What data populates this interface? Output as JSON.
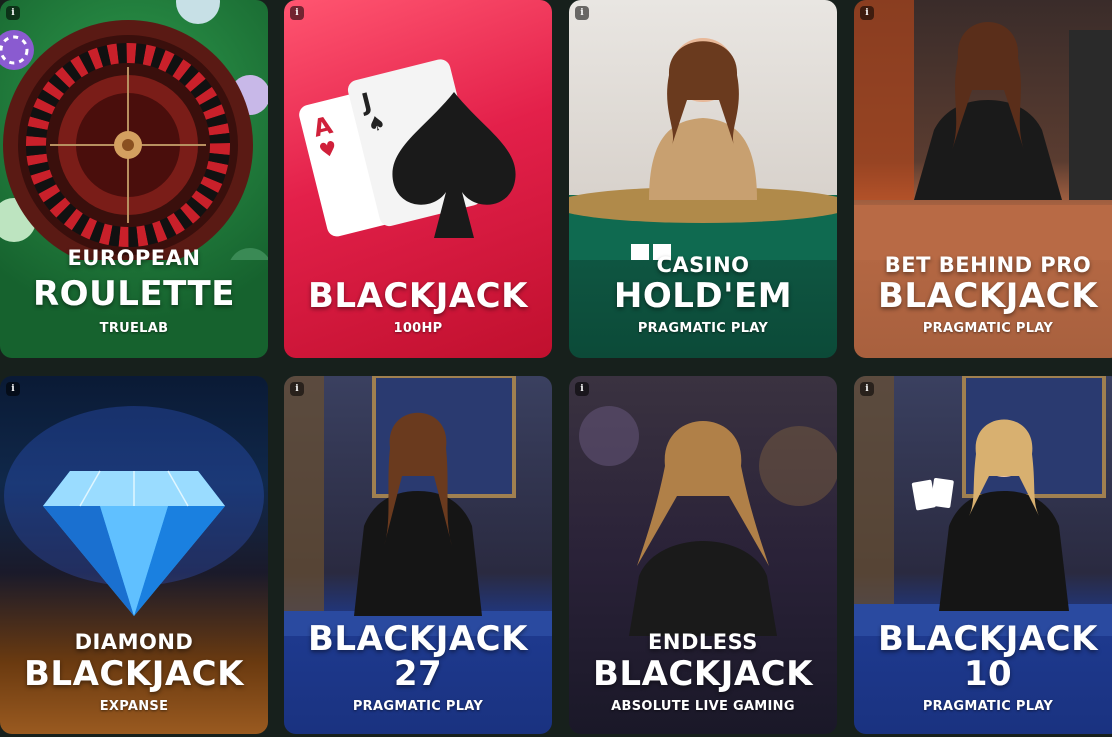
{
  "info_icon": "i",
  "games": [
    {
      "subtitle": "EUROPEAN",
      "title": "ROULETTE",
      "title2": "",
      "provider": "TRUELAB",
      "theme": "green-roulette"
    },
    {
      "subtitle": "",
      "title": "BLACKJACK",
      "title2": "",
      "provider": "100HP",
      "theme": "red-cards"
    },
    {
      "subtitle": "CASINO",
      "title": "HOLD'EM",
      "title2": "",
      "provider": "PRAGMATIC PLAY",
      "theme": "live-dealer-teal"
    },
    {
      "subtitle": "BET BEHIND PRO",
      "title": "BLACKJACK",
      "title2": "",
      "provider": "PRAGMATIC PLAY",
      "theme": "live-dealer-copper"
    },
    {
      "subtitle": "DIAMOND",
      "title": "BLACKJACK",
      "title2": "",
      "provider": "EXPANSE",
      "theme": "diamond"
    },
    {
      "subtitle": "",
      "title": "BLACKJACK",
      "title2": "27",
      "provider": "PRAGMATIC PLAY",
      "theme": "live-dealer-blue"
    },
    {
      "subtitle": "ENDLESS",
      "title": "BLACKJACK",
      "title2": "",
      "provider": "ABSOLUTE LIVE GAMING",
      "theme": "live-dealer-purple"
    },
    {
      "subtitle": "",
      "title": "BLACKJACK",
      "title2": "10",
      "provider": "PRAGMATIC PLAY",
      "theme": "live-dealer-blue"
    }
  ],
  "colors": {
    "page_bg": "#17201c",
    "green": "#1f7a3a",
    "red": "#e0204a",
    "teal": "#0e5a45",
    "copper": "#b86a45",
    "blue": "#1e3a8f",
    "purple": "#2a2740"
  }
}
